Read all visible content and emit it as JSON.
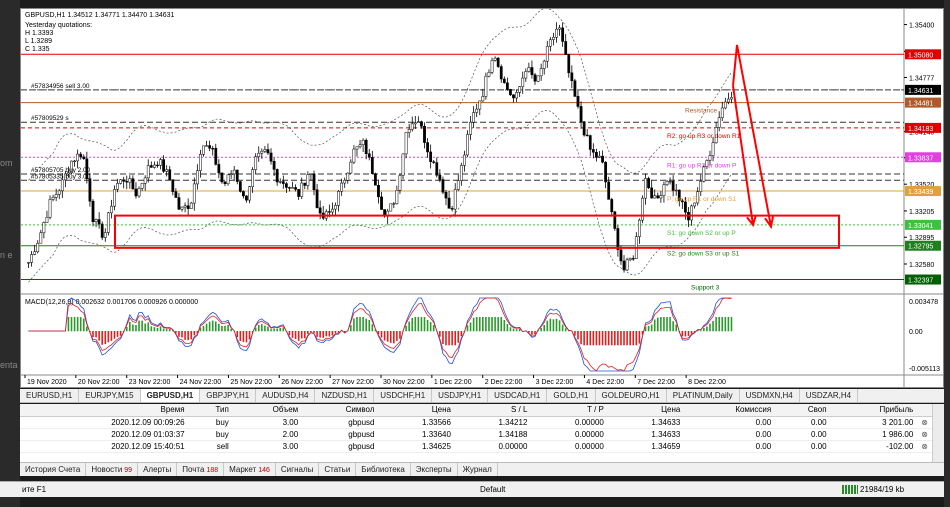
{
  "header": {
    "symbol_line": "GBPUSD,H1  1.34512 1.34771 1.34470 1.34631",
    "yesterday_title": "Yesterday quotations:",
    "yesterday_h": "H 1.3393",
    "yesterday_l": "L 1.3289",
    "yesterday_c": "C 1.335"
  },
  "ghost_text": [
    "om",
    "n e",
    "enta",
    "ите F1"
  ],
  "price_axis": {
    "ticks": [
      {
        "label": "1.35400",
        "v": 1.354
      },
      {
        "label": "1.35085",
        "v": 1.35085
      },
      {
        "label": "1.34777",
        "v": 1.34777
      },
      {
        "label": "1.34140",
        "v": 1.3414
      },
      {
        "label": "1.33832",
        "v": 1.33832
      },
      {
        "label": "1.33520",
        "v": 1.3352
      },
      {
        "label": "1.33205",
        "v": 1.33205
      },
      {
        "label": "1.32895",
        "v": 1.32895
      },
      {
        "label": "1.32580",
        "v": 1.3258
      }
    ],
    "boxes": [
      {
        "label": "1.35080",
        "v": 1.3505,
        "color": "#e00000"
      },
      {
        "label": "1.34631",
        "v": 1.34631,
        "color": "#000000"
      },
      {
        "label": "1.34481",
        "v": 1.34481,
        "color": "#b05a2a"
      },
      {
        "label": "1.34183",
        "v": 1.34183,
        "color": "#e00000"
      },
      {
        "label": "1.33837",
        "v": 1.33837,
        "color": "#e040e0"
      },
      {
        "label": "1.33439",
        "v": 1.33439,
        "color": "#e0a040"
      },
      {
        "label": "1.33041",
        "v": 1.33041,
        "color": "#40c040"
      },
      {
        "label": "1.32795",
        "v": 1.32795,
        "color": "#208020"
      },
      {
        "label": "1.32397",
        "v": 1.32397,
        "color": "#006000"
      }
    ],
    "macd_ticks": [
      "0.003478",
      "0.00",
      "-0.005113"
    ]
  },
  "order_labels": [
    {
      "text": "#57834956 sell 3.00",
      "v": 1.34631
    },
    {
      "text": "#57809529 s",
      "v": 1.3425
    },
    {
      "text": "#57805705 buy 2.00",
      "v": 1.3364
    },
    {
      "text": "#57805335 buy 3.00",
      "v": 1.33566
    }
  ],
  "level_labels": [
    {
      "text": "Resistance",
      "v": 1.34481,
      "color": "#b05a2a"
    },
    {
      "text": "R2: go up R3 or down R1",
      "v": 1.34183,
      "color": "#e00000"
    },
    {
      "text": "R1: go up R2 or down P",
      "v": 1.33837,
      "color": "#e040e0"
    },
    {
      "text": "P: go up R1 or down S1",
      "v": 1.33439,
      "color": "#e0a040"
    },
    {
      "text": "S1: go down S2 or up P",
      "v": 1.33041,
      "color": "#40c040"
    },
    {
      "text": "S2: go down S3 or up S1",
      "v": 1.32795,
      "color": "#208020"
    },
    {
      "text": "Support 3",
      "v": 1.32397,
      "color": "#006000"
    }
  ],
  "macd": {
    "label": "MACD(12,26,9) 0.002632 0.001706 0.000926 0.000000"
  },
  "time_axis": [
    "19 Nov 2020",
    "20 Nov 22:00",
    "23 Nov 22:00",
    "24 Nov 22:00",
    "25 Nov 22:00",
    "26 Nov 22:00",
    "27 Nov 22:00",
    "30 Nov 22:00",
    "1 Dec 22:00",
    "2 Dec 22:00",
    "3 Dec 22:00",
    "4 Dec 22:00",
    "7 Dec 22:00",
    "8 Dec 22:00"
  ],
  "symbol_tabs": [
    "EURUSD,H1",
    "EURJPY,M15",
    "GBPUSD,H1",
    "GBPJPY,H1",
    "AUDUSD,H4",
    "NZDUSD,H1",
    "USDCHF,H1",
    "USDJPY,H1",
    "USDCAD,H1",
    "GOLD,H1",
    "GOLDEURO,H1",
    "PLATINUM,Daily",
    "USDMXN,H4",
    "USDZAR,H4"
  ],
  "active_symbol_tab": 2,
  "terminal": {
    "columns": [
      "Время",
      "Тип",
      "Объем",
      "Символ",
      "Цена",
      "S / L",
      "T / P",
      "Цена",
      "Комиссия",
      "Своп",
      "Прибыль"
    ],
    "rows": [
      [
        "2020.12.09 00:09:26",
        "buy",
        "3.00",
        "gbpusd",
        "1.33566",
        "1.34212",
        "0.00000",
        "1.34633",
        "0.00",
        "0.00",
        "3 201.00"
      ],
      [
        "2020.12.09 01:03:37",
        "buy",
        "2.00",
        "gbpusd",
        "1.33640",
        "1.34188",
        "0.00000",
        "1.34633",
        "0.00",
        "0.00",
        "1 986.00"
      ],
      [
        "2020.12.09 15:40:51",
        "sell",
        "3.00",
        "gbpusd",
        "1.34625",
        "0.00000",
        "0.00000",
        "1.34659",
        "0.00",
        "0.00",
        "-102.00"
      ]
    ],
    "close_glyph": "⊗"
  },
  "bottom_tabs": [
    {
      "label": "История Счета",
      "count": ""
    },
    {
      "label": "Новости",
      "count": "99"
    },
    {
      "label": "Алерты",
      "count": ""
    },
    {
      "label": "Почта",
      "count": "188"
    },
    {
      "label": "Маркет",
      "count": "146"
    },
    {
      "label": "Сигналы",
      "count": ""
    },
    {
      "label": "Статьи",
      "count": ""
    },
    {
      "label": "Библиотека",
      "count": ""
    },
    {
      "label": "Эксперты",
      "count": ""
    },
    {
      "label": "Журнал",
      "count": ""
    }
  ],
  "status": {
    "help": "ите F1",
    "profile": "Default",
    "traffic": "21984/19 kb"
  },
  "colors": {
    "bull": "#000000",
    "bear": "#000000",
    "macd_up": "#2a9a2a",
    "macd_down": "#e02020",
    "arrow": "#ff0000",
    "box": "#ff0000"
  },
  "chart_data": {
    "type": "candlestick",
    "symbol": "GBPUSD",
    "timeframe": "H1",
    "ylim": [
      1.3225,
      1.3556
    ],
    "close_path": [
      1.326,
      1.329,
      1.333,
      1.335,
      1.338,
      1.339,
      1.331,
      1.329,
      1.335,
      1.336,
      1.334,
      1.337,
      1.338,
      1.336,
      1.332,
      1.333,
      1.34,
      1.339,
      1.335,
      1.337,
      1.333,
      1.338,
      1.339,
      1.336,
      1.335,
      1.334,
      1.337,
      1.331,
      1.332,
      1.335,
      1.339,
      1.34,
      1.336,
      1.331,
      1.334,
      1.342,
      1.343,
      1.339,
      1.336,
      1.332,
      1.337,
      1.343,
      1.346,
      1.351,
      1.347,
      1.345,
      1.349,
      1.347,
      1.351,
      1.354,
      1.348,
      1.343,
      1.339,
      1.338,
      1.331,
      1.325,
      1.327,
      1.336,
      1.333,
      1.336,
      1.334,
      1.331,
      1.335,
      1.339,
      1.344,
      1.346
    ],
    "levels": [
      1.3505,
      1.34481,
      1.34183,
      1.33837,
      1.33439,
      1.33041,
      1.32795,
      1.32397
    ]
  }
}
